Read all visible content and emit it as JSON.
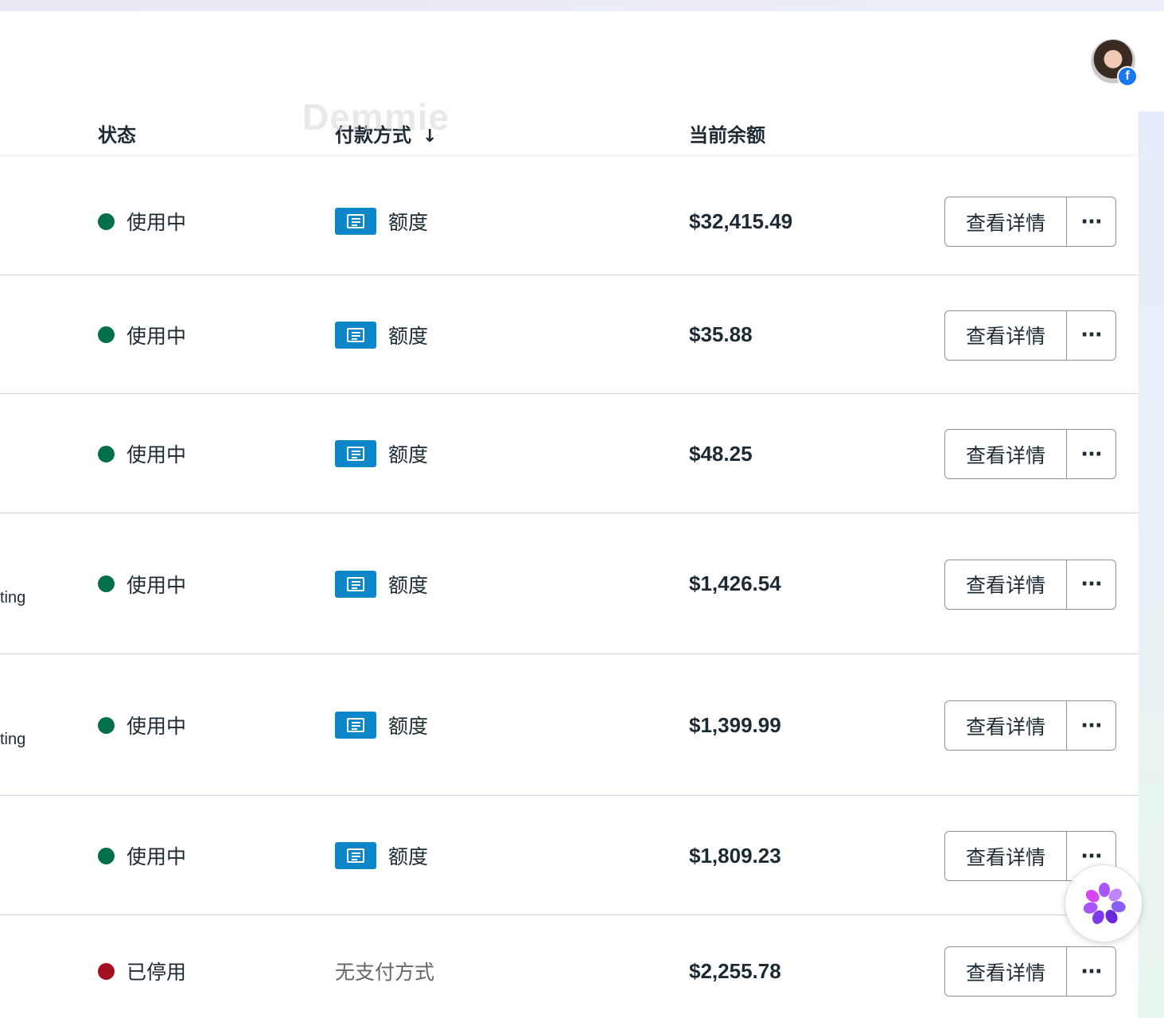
{
  "table": {
    "headers": {
      "status": "状态",
      "payment": "付款方式",
      "balance": "当前余额"
    },
    "watermark": "Demmie",
    "rows": [
      {
        "status": "使用中",
        "status_color": "#00704a",
        "side_text": "",
        "payment": "额度",
        "has_payment": true,
        "balance": "$32,415.49"
      },
      {
        "status": "使用中",
        "status_color": "#00704a",
        "side_text": "",
        "payment": "额度",
        "has_payment": true,
        "balance": "$35.88"
      },
      {
        "status": "使用中",
        "status_color": "#00704a",
        "side_text": "",
        "payment": "额度",
        "has_payment": true,
        "balance": "$48.25"
      },
      {
        "status": "使用中",
        "status_color": "#00704a",
        "side_text": "ting",
        "payment": "额度",
        "has_payment": true,
        "balance": "$1,426.54"
      },
      {
        "status": "使用中",
        "status_color": "#00704a",
        "side_text": "ting",
        "payment": "额度",
        "has_payment": true,
        "balance": "$1,399.99"
      },
      {
        "status": "使用中",
        "status_color": "#00704a",
        "side_text": "",
        "payment": "额度",
        "has_payment": true,
        "balance": "$1,809.23"
      },
      {
        "status": "已停用",
        "status_color": "#a50f21",
        "side_text": "",
        "payment": "无支付方式",
        "has_payment": false,
        "balance": "$2,255.78"
      }
    ],
    "detail_button_label": "查看详情",
    "more_button_label": "···"
  },
  "header": {
    "avatar_badge": "f"
  },
  "colors": {
    "accent_blue": "#0a86c9",
    "facebook_blue": "#1877f2"
  }
}
